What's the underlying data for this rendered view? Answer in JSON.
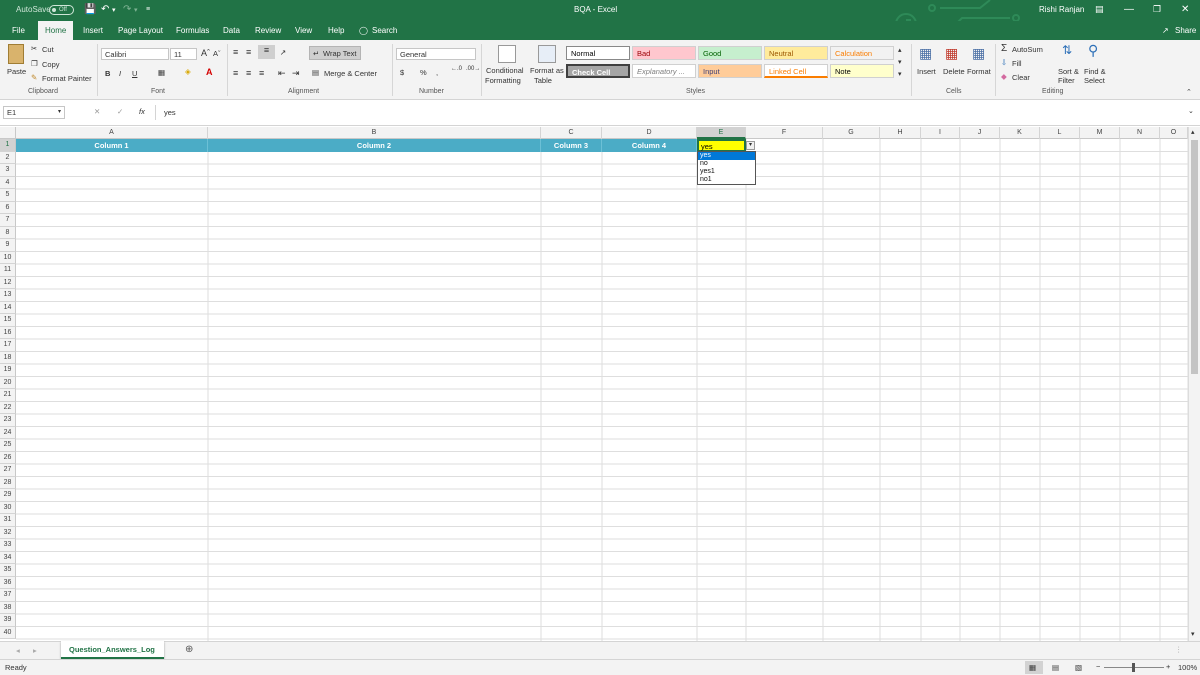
{
  "titlebar": {
    "autosave_label": "AutoSave",
    "autosave_state": "Off",
    "title": "BQA  -  Excel",
    "user": "Rishi Ranjan"
  },
  "tabs": [
    "File",
    "Home",
    "Insert",
    "Page Layout",
    "Formulas",
    "Data",
    "Review",
    "View",
    "Help"
  ],
  "search_label": "Search",
  "share_label": "Share",
  "ribbon": {
    "clipboard": {
      "paste": "Paste",
      "cut": "Cut",
      "copy": "Copy",
      "format_painter": "Format Painter",
      "label": "Clipboard"
    },
    "font": {
      "name": "Calibri",
      "size": "11",
      "bold": "B",
      "italic": "I",
      "underline": "U",
      "label": "Font"
    },
    "alignment": {
      "wrap_text": "Wrap Text",
      "merge_center": "Merge & Center",
      "label": "Alignment"
    },
    "number": {
      "format": "General",
      "currency": "$",
      "percent": "%",
      "comma": ",",
      "label": "Number"
    },
    "styles": {
      "conditional": "Conditional",
      "conditional2": "Formatting",
      "format_as": "Format as",
      "format_as2": "Table",
      "cells": [
        {
          "name": "Normal",
          "bg": "#ffffff",
          "fg": "#000000"
        },
        {
          "name": "Bad",
          "bg": "#ffc7ce",
          "fg": "#9c0006"
        },
        {
          "name": "Good",
          "bg": "#c6efce",
          "fg": "#006100"
        },
        {
          "name": "Neutral",
          "bg": "#ffeb9c",
          "fg": "#9c5700"
        },
        {
          "name": "Calculation",
          "bg": "#f2f2f2",
          "fg": "#fa7d00"
        },
        {
          "name": "Check Cell",
          "bg": "#a5a5a5",
          "fg": "#ffffff"
        },
        {
          "name": "Explanatory ...",
          "bg": "#ffffff",
          "fg": "#7f7f7f"
        },
        {
          "name": "Input",
          "bg": "#ffcc99",
          "fg": "#3f3f76"
        },
        {
          "name": "Linked Cell",
          "bg": "#ffffff",
          "fg": "#fa7d00"
        },
        {
          "name": "Note",
          "bg": "#ffffcc",
          "fg": "#000000"
        }
      ],
      "label": "Styles"
    },
    "cells": {
      "insert": "Insert",
      "delete": "Delete",
      "format": "Format",
      "label": "Cells"
    },
    "editing": {
      "autosum": "AutoSum",
      "fill": "Fill",
      "clear": "Clear",
      "sort": "Sort &",
      "sort2": "Filter",
      "find": "Find &",
      "find2": "Select",
      "label": "Editing"
    }
  },
  "formula_bar": {
    "name_box": "E1",
    "fx": "fx",
    "value": "yes"
  },
  "columns": [
    "A",
    "B",
    "C",
    "D",
    "E",
    "F",
    "G",
    "H",
    "I",
    "J",
    "K",
    "L",
    "M",
    "N",
    "O"
  ],
  "selected_column": "E",
  "selected_row": "1",
  "rows": [
    "1",
    "2",
    "3",
    "4",
    "5",
    "6",
    "7",
    "8",
    "9",
    "10",
    "11",
    "12",
    "13",
    "14",
    "15",
    "16",
    "17",
    "18",
    "19",
    "20",
    "21",
    "22",
    "23",
    "24",
    "25",
    "26",
    "27",
    "28",
    "29",
    "30",
    "31",
    "32",
    "33",
    "34",
    "35",
    "36",
    "37",
    "38",
    "39",
    "40"
  ],
  "header_row": [
    "Column 1",
    "Column 2",
    "Column 3",
    "Column 4"
  ],
  "active_cell_value": "yes",
  "dropdown_options": [
    "yes",
    "no",
    "yes1",
    "no1"
  ],
  "sheet_tab": "Question_Answers_Log",
  "status": {
    "ready": "Ready",
    "zoom": "100%"
  }
}
